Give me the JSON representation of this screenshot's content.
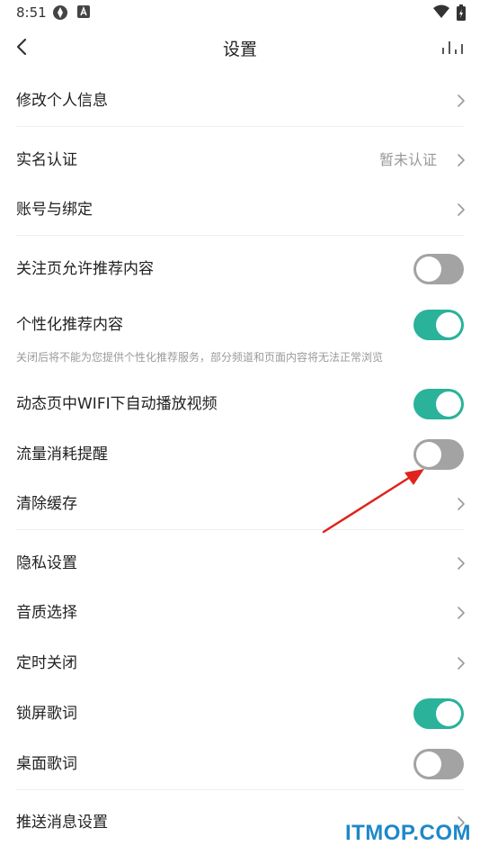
{
  "status_bar": {
    "time": "8:51"
  },
  "nav": {
    "title": "设置"
  },
  "settings": {
    "edit_profile": "修改个人信息",
    "realname_auth": "实名认证",
    "realname_status": "暂未认证",
    "account_binding": "账号与绑定",
    "follow_recommend": "关注页允许推荐内容",
    "personalized_recommend": "个性化推荐内容",
    "personalized_hint": "关闭后将不能为您提供个性化推荐服务，部分频道和页面内容将无法正常浏览",
    "wifi_autoplay": "动态页中WIFI下自动播放视频",
    "data_usage_reminder": "流量消耗提醒",
    "clear_cache": "清除缓存",
    "privacy_settings": "隐私设置",
    "audio_quality": "音质选择",
    "timer_close": "定时关闭",
    "lockscreen_lyrics": "锁屏歌词",
    "desktop_lyrics": "桌面歌词",
    "push_settings": "推送消息设置"
  },
  "toggles": {
    "follow_recommend": false,
    "personalized_recommend": true,
    "wifi_autoplay": true,
    "data_usage_reminder": false,
    "lockscreen_lyrics": true,
    "desktop_lyrics": false
  },
  "colors": {
    "toggle_on": "#2ab29a",
    "toggle_off": "#a3a3a3",
    "annotation_arrow": "#e0231c",
    "watermark": "#1e88c8"
  },
  "watermark": "ITMOP.COM"
}
